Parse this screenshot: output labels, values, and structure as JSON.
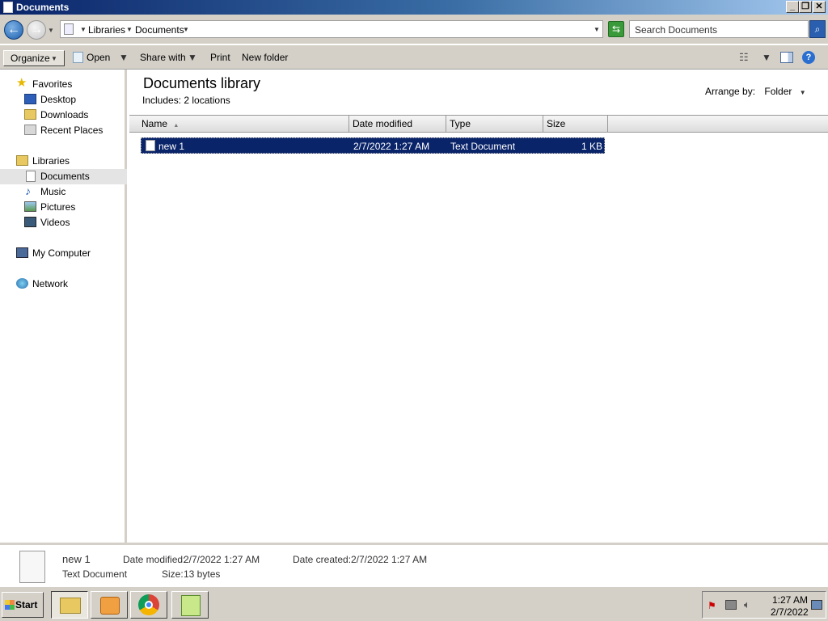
{
  "window": {
    "title": "Documents"
  },
  "address": {
    "crumbs": [
      "Libraries",
      "Documents"
    ],
    "search_placeholder": "Search Documents"
  },
  "toolbar": {
    "organize": "Organize",
    "open": "Open",
    "share_with": "Share with",
    "print": "Print",
    "new_folder": "New folder"
  },
  "nav": {
    "favorites": "Favorites",
    "desktop": "Desktop",
    "downloads": "Downloads",
    "recent_places": "Recent Places",
    "libraries": "Libraries",
    "documents": "Documents",
    "music": "Music",
    "pictures": "Pictures",
    "videos": "Videos",
    "my_computer": "My Computer",
    "network": "Network"
  },
  "content": {
    "title": "Documents library",
    "includes_label": "Includes:",
    "includes_value": "2 locations",
    "arrange_label": "Arrange by:",
    "arrange_value": "Folder",
    "columns": [
      "Name",
      "Date modified",
      "Type",
      "Size"
    ],
    "files": [
      {
        "name": "new 1",
        "date_modified": "2/7/2022 1:27 AM",
        "type": "Text Document",
        "size": "1 KB"
      }
    ]
  },
  "details": {
    "name": "new 1",
    "type": "Text Document",
    "date_modified_label": "Date modified:",
    "date_modified": "2/7/2022 1:27 AM",
    "date_created_label": "Date created:",
    "date_created": "2/7/2022 1:27 AM",
    "size_label": "Size:",
    "size": "13 bytes"
  },
  "taskbar": {
    "start": "Start",
    "time": "1:27 AM",
    "date": "2/7/2022"
  }
}
